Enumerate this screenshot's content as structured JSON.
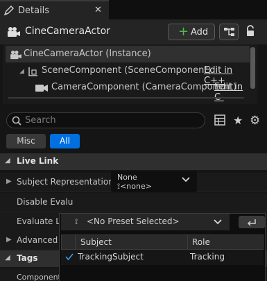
{
  "tab": {
    "label": "Details",
    "close": "✕"
  },
  "actor": {
    "title": "CineCameraActor",
    "add_label": "Add",
    "add_plus": "+"
  },
  "tree": {
    "instance": "CineCameraActor (Instance)",
    "scene": "SceneComponent (SceneComponent)",
    "camera": "CameraComponent (CameraComponent)",
    "edit_link": "Edit in C++",
    "edit_link_clipped": "Edit in C-"
  },
  "search": {
    "placeholder": "Search"
  },
  "filters": {
    "misc": "Misc",
    "all": "All"
  },
  "sections": {
    "live_link": "Live Link",
    "tags": "Tags"
  },
  "properties": {
    "subject_representation": "Subject Representation",
    "disable_eval": "Disable Evalu",
    "evaluate_live": "Evaluate Liv",
    "advanced": "Advanced",
    "component": "Component T"
  },
  "subject_value": {
    "label": "None",
    "value": "<none>"
  },
  "popup": {
    "preset": "<No Preset Selected>",
    "columns": [
      "Subject",
      "Role"
    ],
    "rows": [
      {
        "subject": "TrackingSubject",
        "role": "Tracking"
      }
    ]
  },
  "colors": {
    "accent": "#0070e0",
    "add_green": "#4cbc4c"
  }
}
